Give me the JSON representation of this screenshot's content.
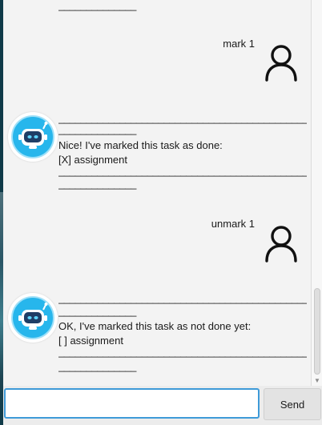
{
  "separator_long": "_____________________________________________________",
  "separator_short": "______________",
  "messages": {
    "user_mark": "mark 1",
    "bot_mark_line1": "Nice! I've marked this task as done:",
    "bot_mark_line2": "[X] assignment",
    "user_unmark": "unmark 1",
    "bot_unmark_line1": "OK, I've marked this task as not done yet:",
    "bot_unmark_line2": "[ ] assignment"
  },
  "icons": {
    "user": "user-silhouette-icon",
    "bot": "robot-head-icon",
    "scroll_down": "chevron-down-icon"
  },
  "colors": {
    "bot_ring": "#27b6ec",
    "bot_face": "#1f3e66",
    "input_focus": "#3e9ad8"
  },
  "input": {
    "value": "",
    "placeholder": "",
    "send_label": "Send"
  }
}
